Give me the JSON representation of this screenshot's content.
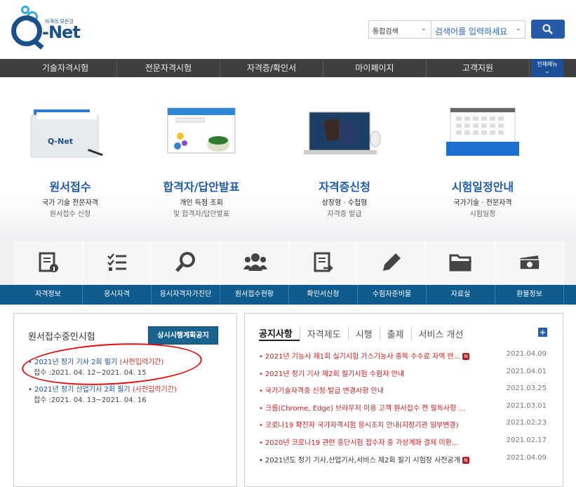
{
  "logo": {
    "small_text": "자격의 모든것",
    "name": "Net"
  },
  "search": {
    "scope": "통합검색",
    "placeholder": "검색어를 입력하세요"
  },
  "gnb": {
    "items": [
      "기술자격시험",
      "전문자격시험",
      "자격증/확인서",
      "마이페이지",
      "고객지원"
    ],
    "all_menu": "전체메뉴"
  },
  "hero": [
    {
      "title": "원서접수",
      "sub1": "국가 기술 전문자격",
      "sub2": "원서접수 신청"
    },
    {
      "title": "합격자/답안발표",
      "sub1": "개인 득점 조회",
      "sub2": "및 합격자/답안발표"
    },
    {
      "title": "자격증신청",
      "sub1": "상장형 · 수첩형",
      "sub2": "자격증 발급"
    },
    {
      "title": "시험일정안내",
      "sub1": "국가기술 · 전문자격",
      "sub2": "시험일정"
    }
  ],
  "quick": [
    "자격정보",
    "응시자격",
    "응시자격자가진단",
    "원서접수현황",
    "확인서신청",
    "수험자준비물",
    "자료실",
    "환불정보"
  ],
  "left_panel": {
    "title": "원서접수중인시험",
    "button": "상시시행계획공지",
    "items": [
      {
        "title": "2021년 정기 기사 2회 필기",
        "tag": "(사전입력기간)",
        "date": "접수 :2021. 04. 12~2021. 04. 15"
      },
      {
        "title": "2021년 정기 산업기사 2회 필기",
        "tag": "(사전입력기간)",
        "date": "접수 :2021. 04. 13~2021. 04. 16"
      }
    ]
  },
  "right_panel": {
    "tabs": [
      "공지사항",
      "자격제도",
      "시행",
      "출제",
      "서비스 개선"
    ],
    "plus": "+",
    "rows": [
      {
        "text": "2021년 기능사 제1회 실기시험 가스기능사 종목 수수료 자액 반...",
        "new": "N",
        "date": "2021.04.09"
      },
      {
        "text": "2021년 정기 기사 제2회 필기시험 수험자 안내",
        "new": "",
        "date": "2021.04.01"
      },
      {
        "text": "국가기술자격증 신청·발급 변경사항 안내",
        "new": "",
        "date": "2021.03.25"
      },
      {
        "text": "크롬(Chrome, Edge) 브라우저 이용 고객 원서접수 전 필독사항 ...",
        "new": "",
        "date": "2021.03.01"
      },
      {
        "text": "코로나19 확진자 국가자격시험 응시조치 안내(지정기관 일부변경)",
        "new": "",
        "date": "2021.02.23"
      },
      {
        "text": "2020년 코로나19 관련 중단시험 접수자 중 가상계좌 결제 미환...",
        "new": "",
        "date": "2021.02.17"
      },
      {
        "text": "2021년도 정기 기사,산업기사,서비스 제2회 필기 시험장 사전공개",
        "new": "N",
        "date": "2021.04.09"
      }
    ]
  },
  "colors": {
    "brand": "#1b4f8a",
    "nav": "#3f3f3f",
    "quickbar": "#0e5b8f",
    "accent_red": "#d32d2d"
  }
}
